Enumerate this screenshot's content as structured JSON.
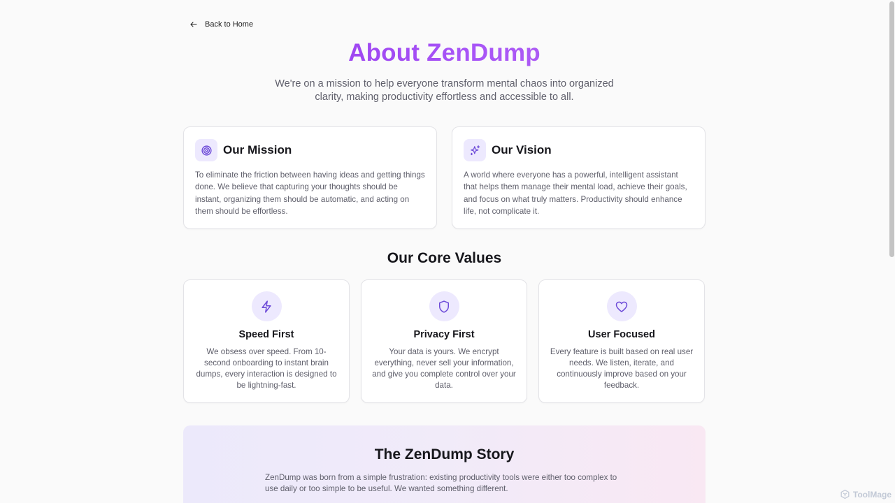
{
  "nav": {
    "back_label": "Back to Home"
  },
  "hero": {
    "title": "About ZenDump",
    "subtitle": "We're on a mission to help everyone transform mental chaos into organized clarity, making productivity effortless and accessible to all."
  },
  "mission": {
    "icon": "target-icon",
    "title": "Our Mission",
    "text": "To eliminate the friction between having ideas and getting things done. We believe that capturing your thoughts should be instant, organizing them should be automatic, and acting on them should be effortless."
  },
  "vision": {
    "icon": "sparkles-icon",
    "title": "Our Vision",
    "text": "A world where everyone has a powerful, intelligent assistant that helps them manage their mental load, achieve their goals, and focus on what truly matters. Productivity should enhance life, not complicate it."
  },
  "values": {
    "title": "Our Core Values",
    "items": [
      {
        "icon": "lightning-icon",
        "title": "Speed First",
        "text": "We obsess over speed. From 10-second onboarding to instant brain dumps, every interaction is designed to be lightning-fast."
      },
      {
        "icon": "shield-icon",
        "title": "Privacy First",
        "text": "Your data is yours. We encrypt everything, never sell your information, and give you complete control over your data."
      },
      {
        "icon": "heart-icon",
        "title": "User Focused",
        "text": "Every feature is built based on real user needs. We listen, iterate, and continuously improve based on your feedback."
      }
    ]
  },
  "story": {
    "title": "The ZenDump Story",
    "text": "ZenDump was born from a simple frustration: existing productivity tools were either too complex to use daily or too simple to be useful. We wanted something different."
  },
  "watermark": {
    "label": "ToolMage"
  },
  "colors": {
    "accent": "#7c3aed",
    "accent_light": "#ede9fe",
    "title_gradient_start": "#9333ea",
    "title_gradient_end": "#b766ee"
  }
}
